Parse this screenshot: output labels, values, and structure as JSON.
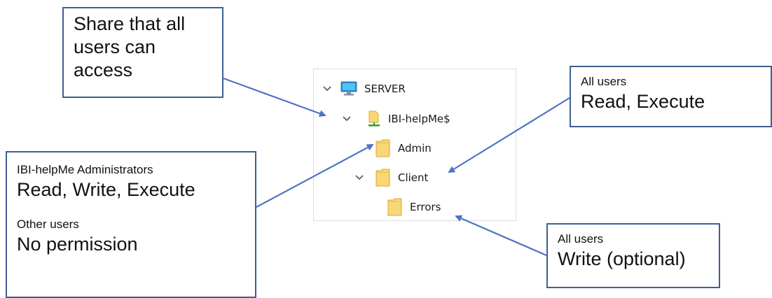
{
  "callouts": {
    "share": {
      "line1": "Share that all",
      "line2": "users can",
      "line3": "access"
    },
    "client_perm": {
      "who": "All users",
      "perm": "Read, Execute"
    },
    "admin_perm": {
      "who1": "IBI-helpMe Administrators",
      "perm1": "Read, Write, Execute",
      "who2": "Other users",
      "perm2": "No permission"
    },
    "errors_perm": {
      "who": "All users",
      "perm": "Write (optional)"
    }
  },
  "tree": {
    "nodes": [
      {
        "label": "SERVER",
        "icon": "computer-icon",
        "expanded": true
      },
      {
        "label": "IBI-helpMe$",
        "icon": "network-share-icon",
        "expanded": true
      },
      {
        "label": "Admin",
        "icon": "folder-icon",
        "expanded": false
      },
      {
        "label": "Client",
        "icon": "folder-icon",
        "expanded": true
      },
      {
        "label": "Errors",
        "icon": "folder-icon",
        "expanded": false
      }
    ]
  },
  "colors": {
    "arrow": "#4f74c4",
    "callout_border": "#3f5f93",
    "folder_fill": "#f8d775",
    "folder_edge": "#d9a933",
    "monitor_blue": "#1e88e5",
    "share_green": "#2e9b2e"
  }
}
